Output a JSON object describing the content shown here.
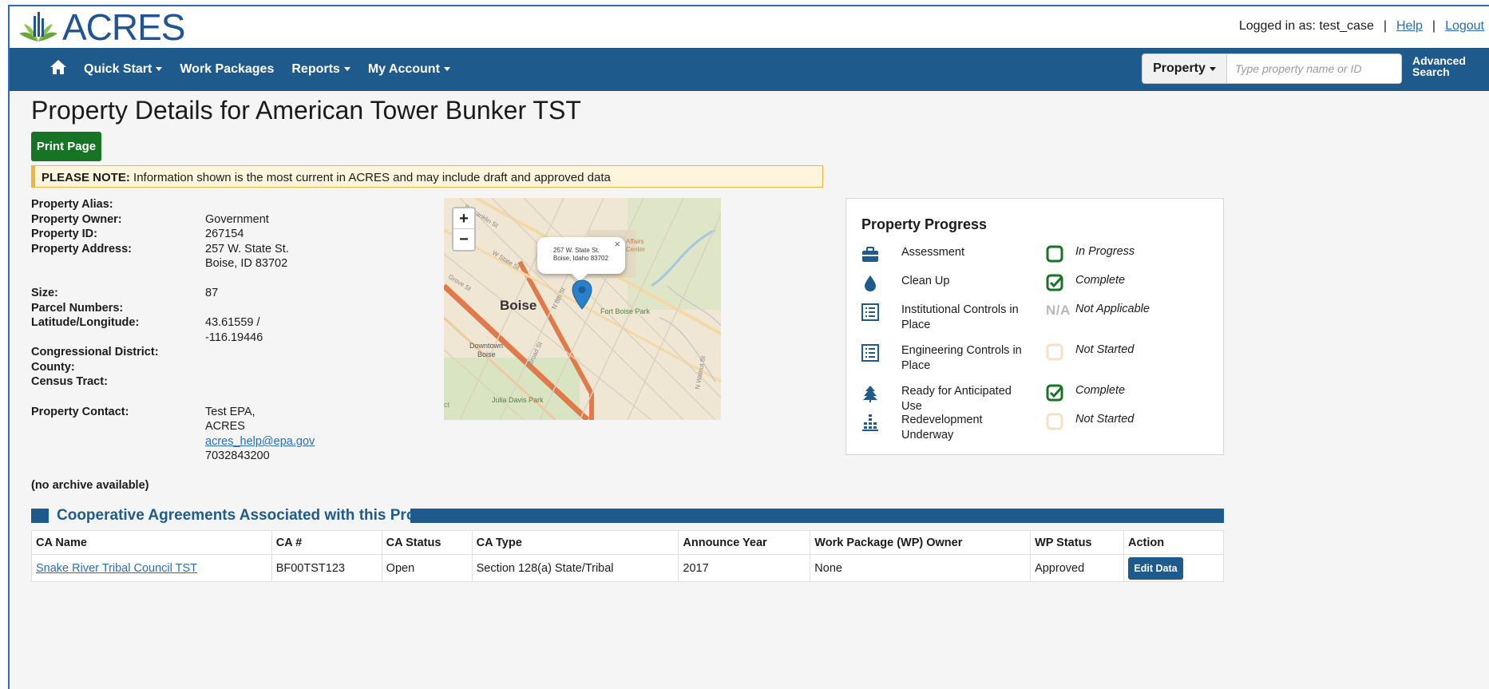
{
  "header": {
    "logo_text": "ACRES",
    "logged_in_label": "Logged in as: test_case",
    "separator": "|",
    "help_label": "Help",
    "logout_label": "Logout"
  },
  "nav": {
    "items": [
      {
        "label": "Quick Start",
        "dropdown": true
      },
      {
        "label": "Work Packages",
        "dropdown": false
      },
      {
        "label": "Reports",
        "dropdown": true
      },
      {
        "label": "My Account",
        "dropdown": true
      }
    ],
    "search_type": "Property",
    "search_placeholder": "Type property name or ID",
    "advanced_search_line1": "Advanced",
    "advanced_search_line2": "Search"
  },
  "page": {
    "title": "Property Details for American Tower Bunker TST",
    "print_button": "Print Page",
    "notice_bold": "PLEASE NOTE:",
    "notice_text": " Information shown is the most current in ACRES and may include draft and approved data",
    "archive_note": "(no archive available)"
  },
  "details": {
    "alias_label": "Property Alias:",
    "owner_label": "Property Owner:",
    "owner_value": "Government",
    "id_label": "Property ID:",
    "id_value": "267154",
    "address_label": "Property Address:",
    "address_line1": "257 W. State St.",
    "address_line2": "Boise, ID 83702",
    "size_label": "Size:",
    "size_value": "87",
    "parcel_label": "Parcel Numbers:",
    "latlong_label": "Latitude/Longitude:",
    "lat_value": "43.61559 /",
    "long_value": "-116.19446",
    "district_label": "Congressional District:",
    "county_label": "County:",
    "census_label": "Census Tract:",
    "contact_label": "Property Contact:",
    "contact_line1": "Test EPA,",
    "contact_line2": "ACRES",
    "contact_email": "acres_help@epa.gov",
    "contact_phone": "7032843200"
  },
  "map": {
    "zoom_in": "+",
    "zoom_out": "−",
    "popup_line1": "257 W. State St.",
    "popup_line2": "Boise, Idaho 83702",
    "popup_close": "×",
    "labels": {
      "city": "Boise",
      "park1": "Fort Boise Park",
      "downtown1": "Downtown",
      "downtown2": "Boise",
      "park2": "Julia Davis Park",
      "affairs": "Affairs",
      "center": "Center",
      "street1": "W State St",
      "street2": "W Franklin St",
      "street3": "Grove St",
      "street4": "N 8th St",
      "street5": "Broad St",
      "street6": "N Walnut St",
      "street_edge": "ct"
    }
  },
  "progress": {
    "title": "Property Progress",
    "items": [
      {
        "label": "Assessment",
        "status": "In Progress",
        "icon": "briefcase-icon",
        "status_icon": "in-progress"
      },
      {
        "label": "Clean Up",
        "status": "Complete",
        "icon": "water-drop-icon",
        "status_icon": "complete"
      },
      {
        "label": "Institutional Controls in Place",
        "status": "Not Applicable",
        "icon": "list-icon",
        "status_icon": "na"
      },
      {
        "label": "Engineering Controls in Place",
        "status": "Not Started",
        "icon": "list-icon",
        "status_icon": "not-started"
      },
      {
        "label": "Ready for Anticipated Use",
        "status": "Complete",
        "icon": "tree-icon",
        "status_icon": "complete"
      },
      {
        "label": "Redevelopment Underway",
        "status": "Not Started",
        "icon": "building-icon",
        "status_icon": "not-started"
      }
    ],
    "na_text": "N/A"
  },
  "ca_section": {
    "title": "Cooperative Agreements Associated with this Property",
    "columns": [
      "CA Name",
      "CA #",
      "CA Status",
      "CA Type",
      "Announce Year",
      "Work Package (WP) Owner",
      "WP Status",
      "Action"
    ],
    "rows": [
      {
        "name": "Snake River Tribal Council TST",
        "number": "BF00TST123",
        "status": "Open",
        "type": "Section 128(a) State/Tribal",
        "year": "2017",
        "owner": "None",
        "wp_status": "Approved",
        "action": "Edit Data"
      }
    ]
  },
  "colors": {
    "brand_blue": "#1f5a8c",
    "print_green": "#187425",
    "link_blue": "#2a6db5",
    "status_green": "#187425",
    "not_started": "#f6e1c4"
  }
}
